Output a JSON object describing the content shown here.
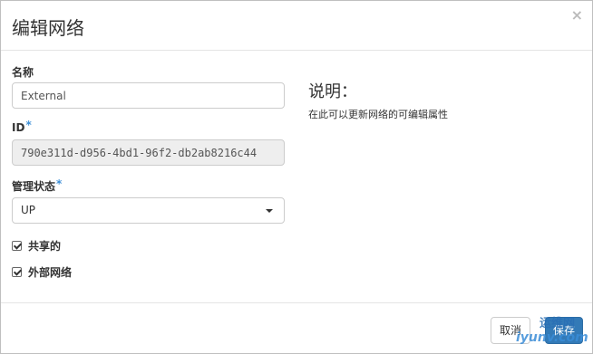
{
  "dialog": {
    "title": "编辑网络",
    "close_glyph": "×"
  },
  "form": {
    "name": {
      "label": "名称",
      "value": "External"
    },
    "id": {
      "label": "ID",
      "required_mark": "*",
      "value": "790e311d-d956-4bd1-96f2-db2ab8216c44"
    },
    "admin_state": {
      "label": "管理状态",
      "required_mark": "*",
      "selected": "UP"
    },
    "shared": {
      "label": "共享的",
      "checked": true
    },
    "external": {
      "label": "外部网络",
      "checked": true
    }
  },
  "help": {
    "title": "说明：",
    "text": "在此可以更新网络的可编辑属性"
  },
  "footer": {
    "cancel_label": "取消",
    "save_label": "保存"
  },
  "watermark": {
    "top": "运维网",
    "bottom": "iyunv.com"
  },
  "colors": {
    "primary": "#337ab7",
    "required": "#3d8fd6",
    "readonly_bg": "#eeeeee"
  }
}
